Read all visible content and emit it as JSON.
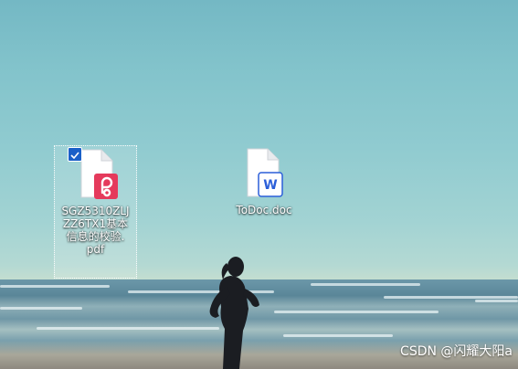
{
  "desktop": {
    "icons": [
      {
        "label": "SGZ5310ZLJZZ6TX1基本信息的校验.pdf",
        "display_lines": "SGZ5310ZLJ\nZZ6TX1基本\n信息的校验.\npdf",
        "type": "pdf",
        "icon": "pdf-file-icon",
        "selected": true,
        "badge_color": "#e53a5c"
      },
      {
        "label": "ToDoc.doc",
        "display_lines": "ToDoc.doc",
        "type": "doc",
        "icon": "word-file-icon",
        "selected": false,
        "badge_color": "#2b5fd9"
      }
    ],
    "wallpaper": "beach-runner-wallpaper",
    "watermark": "CSDN @闪耀大阳a"
  }
}
